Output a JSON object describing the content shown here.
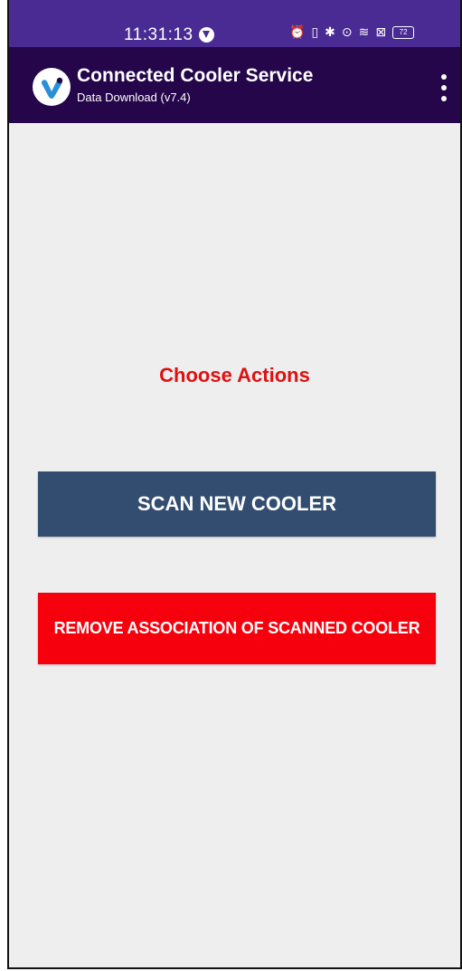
{
  "status_bar": {
    "time": "11:31:13",
    "icons": [
      "vpn-icon",
      "alarm-icon",
      "vibrate-icon",
      "bluetooth-icon",
      "location-icon",
      "wifi-icon",
      "sim-icon",
      "battery-icon"
    ],
    "battery_level": "72",
    "background": "#4a2b93"
  },
  "app_bar": {
    "title": "Connected Cooler Service",
    "subtitle": "Data Download (v7.4)",
    "background": "#25064a"
  },
  "main": {
    "heading": "Choose Actions",
    "heading_color": "#e01010",
    "scan_button_label": "SCAN NEW COOLER",
    "scan_button_color": "#324d70",
    "remove_button_label": "REMOVE ASSOCIATION OF SCANNED COOLER",
    "remove_button_color": "#f5000c"
  }
}
